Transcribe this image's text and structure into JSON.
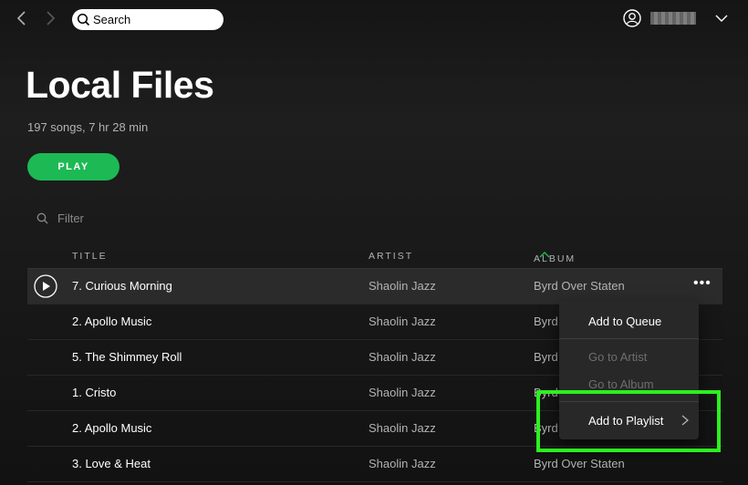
{
  "topbar": {
    "search_placeholder": "Search",
    "user_name": "username"
  },
  "page": {
    "title": "Local Files",
    "subtitle": "197 songs, 7 hr 28 min",
    "play_label": "PLAY",
    "filter_placeholder": "Filter"
  },
  "table": {
    "headers": {
      "title": "TITLE",
      "artist": "ARTIST",
      "album": "ALBUM"
    },
    "rows": [
      {
        "title": "7. Curious Morning",
        "artist": "Shaolin Jazz",
        "album": "Byrd Over Staten"
      },
      {
        "title": "2. Apollo Music",
        "artist": "Shaolin Jazz",
        "album": "Byrd"
      },
      {
        "title": "5. The Shimmey Roll",
        "artist": "Shaolin Jazz",
        "album": "Byrd"
      },
      {
        "title": "1. Cristo",
        "artist": "Shaolin Jazz",
        "album": "Byrd"
      },
      {
        "title": "2. Apollo Music",
        "artist": "Shaolin Jazz",
        "album": "Byrd"
      },
      {
        "title": "3. Love & Heat",
        "artist": "Shaolin Jazz",
        "album": "Byrd Over Staten"
      }
    ]
  },
  "context_menu": {
    "add_to_queue": "Add to Queue",
    "go_to_artist": "Go to Artist",
    "go_to_album": "Go to Album",
    "add_to_playlist": "Add to Playlist"
  },
  "colors": {
    "accent": "#1db954",
    "highlight": "#2cf01f",
    "background": "#181818"
  }
}
